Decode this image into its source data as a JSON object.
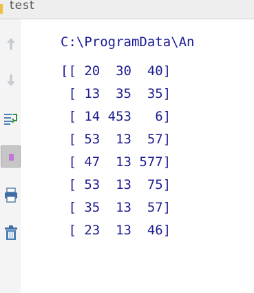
{
  "tab": {
    "title": "test"
  },
  "toolbar": {
    "icons": [
      "scroll-up-arrow-icon",
      "scroll-down-arrow-icon",
      "soft-wrap-icon",
      "stop-icon",
      "print-icon",
      "trash-icon"
    ]
  },
  "console": {
    "command": "C:\\ProgramData\\An",
    "lines": [
      "[[ 20  30  40]",
      " [ 13  35  35]",
      " [ 14 453   6]",
      " [ 53  13  57]",
      " [ 47  13 577]",
      " [ 53  13  75]",
      " [ 35  13  57]",
      " [ 23  13  46]"
    ]
  },
  "colors": {
    "output_text": "#1d1d8f",
    "tab_accent": "#f0c040",
    "toolbar_bg": "#f4f4f4"
  }
}
